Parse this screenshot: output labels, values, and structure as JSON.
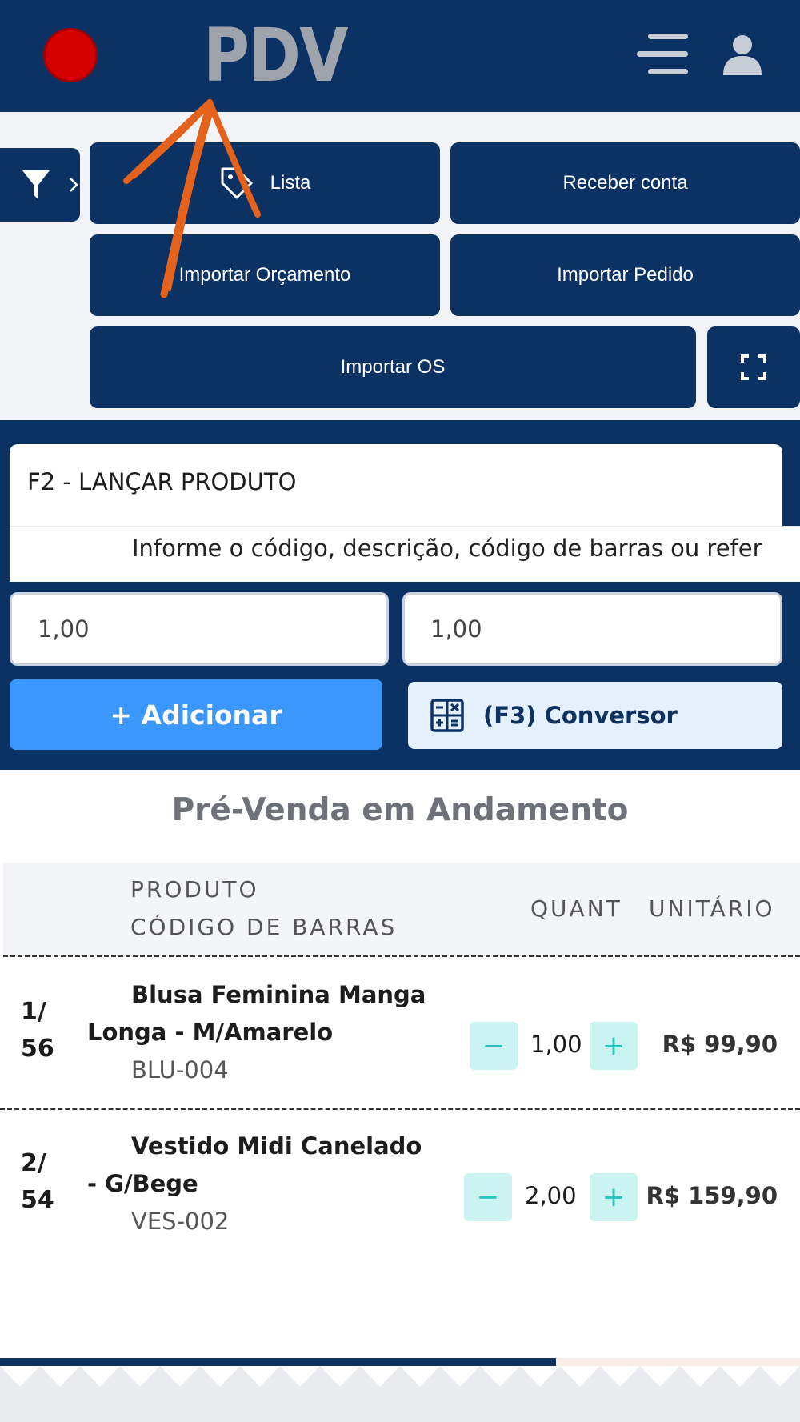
{
  "header": {
    "title": "PDV",
    "record_color": "#d40000",
    "bg_color": "#0b3263"
  },
  "actions": {
    "lista": "Lista",
    "receber_conta": "Receber conta",
    "importar_orcamento": "Importar Orçamento",
    "importar_pedido": "Importar Pedido",
    "importar_os": "Importar OS"
  },
  "lancar": {
    "title": "F2 - LANÇAR PRODUTO",
    "search_placeholder": "Informe o código, descrição, código de barras ou refer"
  },
  "inputs": {
    "quantity": "1,00",
    "price": "1,00"
  },
  "buttons": {
    "adicionar": "+ Adicionar",
    "conversor": "(F3) Conversor"
  },
  "pre_venda": {
    "title": "Pré-Venda em Andamento",
    "columns": {
      "produto": "PRODUTO",
      "codigo_barras": "CÓDIGO DE BARRAS",
      "quant": "QUANT",
      "unitario": "UNITÁRIO"
    },
    "items": [
      {
        "idx_top": "1/",
        "idx_bottom": "56",
        "name_line1": "Blusa Feminina Manga",
        "name_line2": "Longa - M/Amarelo",
        "code": "BLU-004",
        "quantity": "1,00",
        "price": "R$ 99,90"
      },
      {
        "idx_top": "2/",
        "idx_bottom": "54",
        "name_line1": "Vestido Midi Canelado",
        "name_line2": "- G/Bege",
        "code": "VES-002",
        "quantity": "2,00",
        "price": "R$ 159,90"
      }
    ]
  },
  "scroll_progress": 0.695,
  "icons": [
    "record-icon",
    "menu-icon",
    "user-icon",
    "filter-icon",
    "tag-icon",
    "expand-icon",
    "calculator-icon",
    "minus-icon",
    "plus-icon"
  ]
}
